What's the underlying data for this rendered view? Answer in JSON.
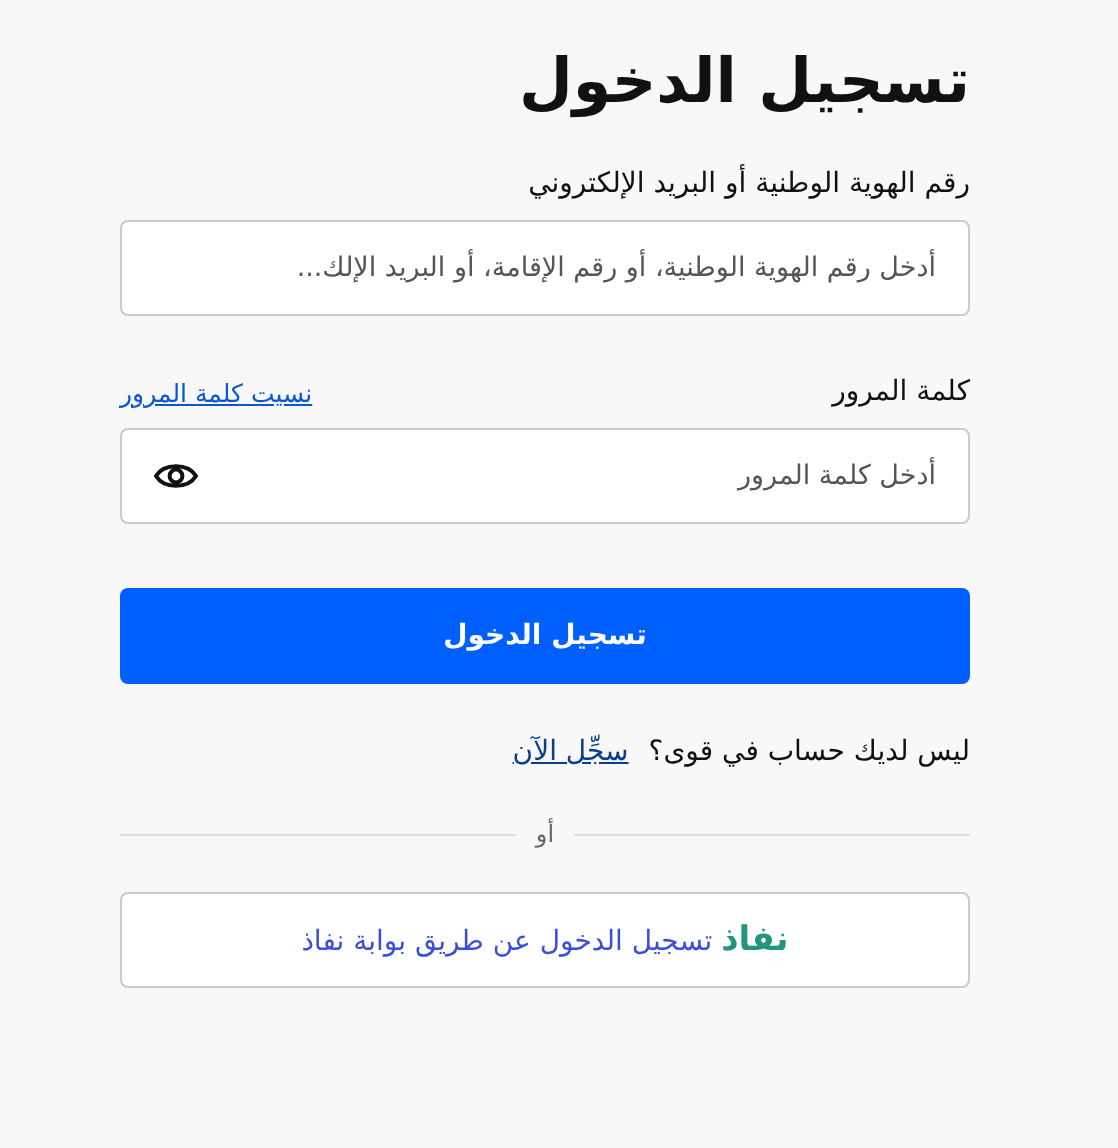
{
  "title": "تسجيل الدخول",
  "id_field": {
    "label": "رقم الهوية الوطنية أو البريد الإلكتروني",
    "placeholder": "أدخل رقم الهوية الوطنية، أو رقم الإقامة، أو البريد الإلك..."
  },
  "password_field": {
    "label": "كلمة المرور",
    "forgot_link": "نسيت كلمة المرور",
    "placeholder": "أدخل كلمة المرور"
  },
  "login_button": "تسجيل الدخول",
  "register": {
    "text": "ليس لديك حساب في قوى؟",
    "link": "سجِّل الآن"
  },
  "divider": "أو",
  "nafath_button": {
    "logo": "نفاذ",
    "label": "تسجيل الدخول عن طريق بوابة نفاذ"
  }
}
